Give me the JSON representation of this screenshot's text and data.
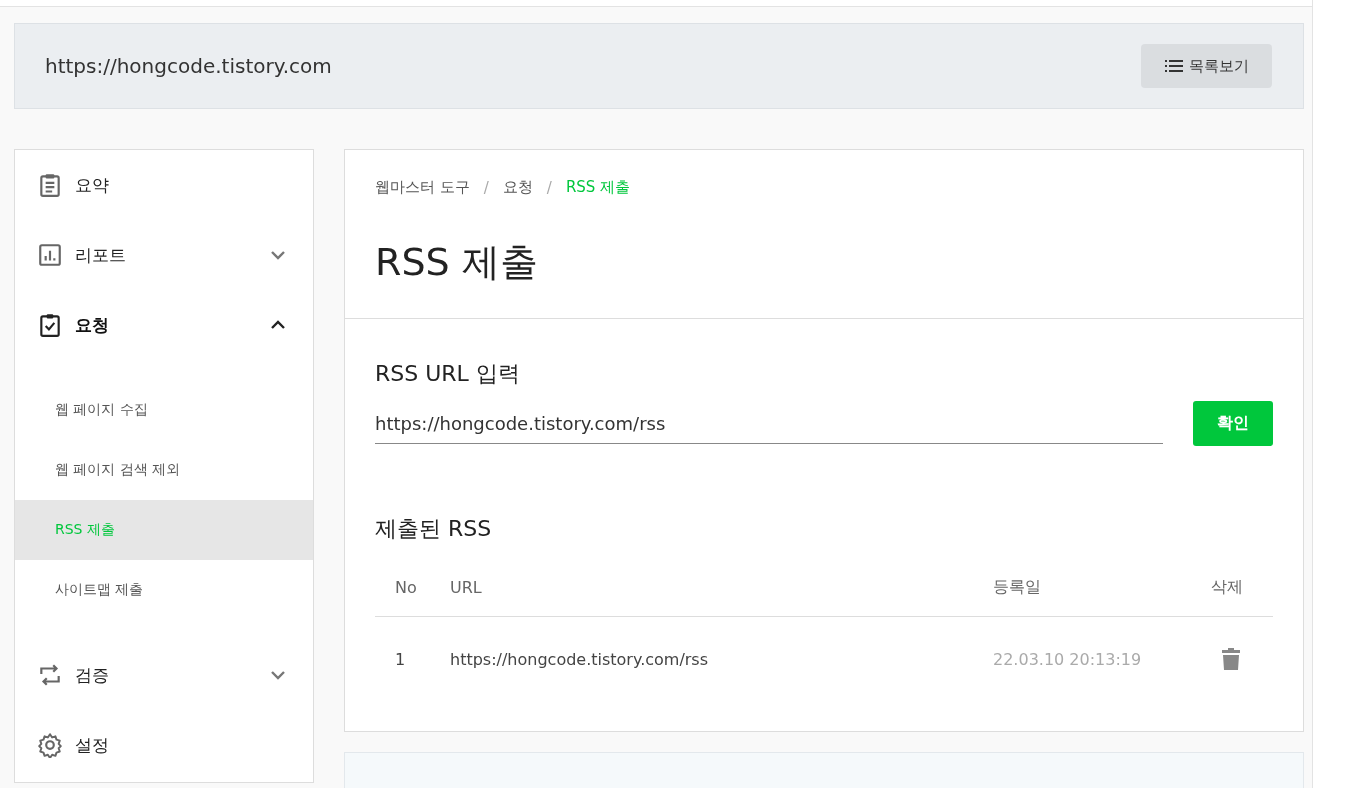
{
  "header": {
    "site_url": "https://hongcode.tistory.com",
    "list_button": "목록보기"
  },
  "sidebar": {
    "items": [
      {
        "label": "요약"
      },
      {
        "label": "리포트",
        "expanded": false
      },
      {
        "label": "요청",
        "expanded": true,
        "children": [
          {
            "label": "웹 페이지 수집",
            "selected": false
          },
          {
            "label": "웹 페이지 검색 제외",
            "selected": false
          },
          {
            "label": "RSS 제출",
            "selected": true
          },
          {
            "label": "사이트맵 제출",
            "selected": false
          }
        ]
      },
      {
        "label": "검증",
        "expanded": false
      },
      {
        "label": "설정"
      }
    ]
  },
  "breadcrumb_separator": "/",
  "breadcrumb": [
    {
      "label": "웹마스터 도구",
      "current": false
    },
    {
      "label": "요청",
      "current": false
    },
    {
      "label": "RSS 제출",
      "current": true
    }
  ],
  "title": "RSS 제출",
  "form": {
    "label": "RSS URL 입력",
    "value": "https://hongcode.tistory.com/rss",
    "submit": "확인"
  },
  "table": {
    "title": "제출된 RSS",
    "columns": [
      "No",
      "URL",
      "등록일",
      "삭제"
    ],
    "rows": [
      {
        "no": "1",
        "url": "https://hongcode.tistory.com/rss",
        "date": "22.03.10 20:13:19"
      }
    ]
  }
}
